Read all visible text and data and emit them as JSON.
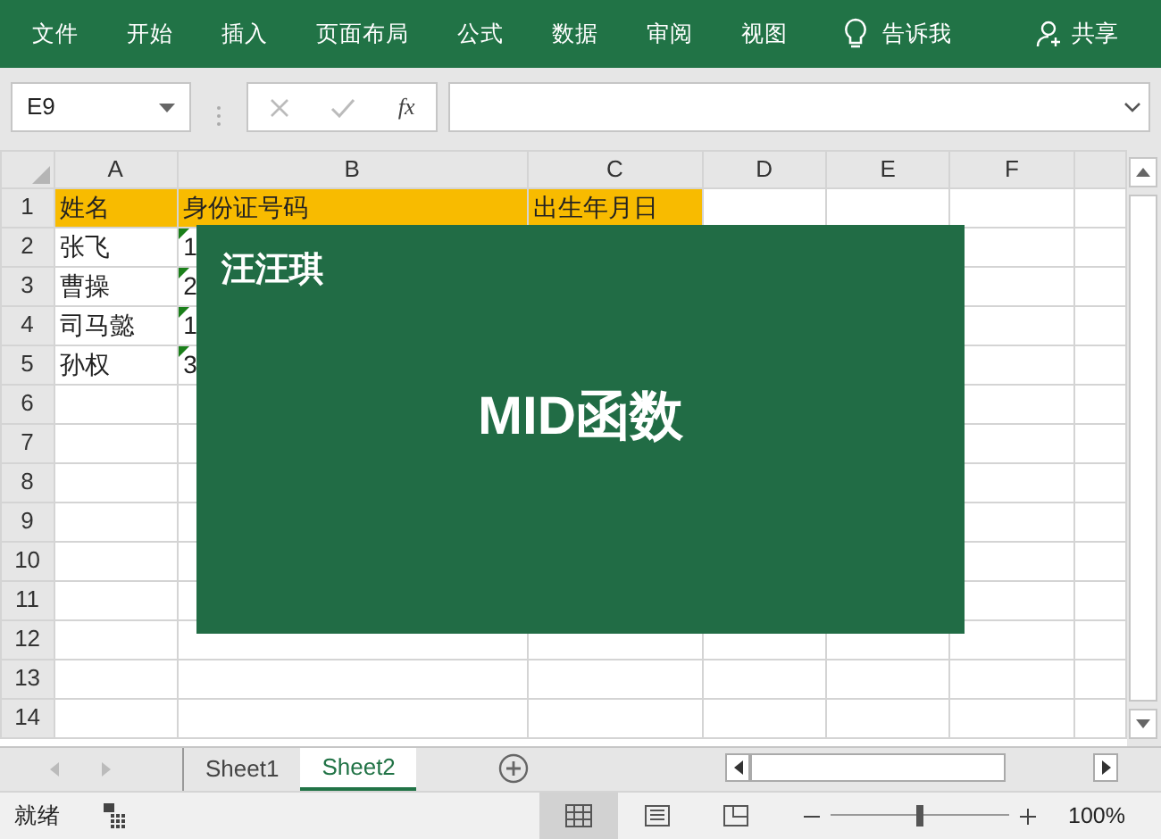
{
  "menu": {
    "tabs": [
      "文件",
      "开始",
      "插入",
      "页面布局",
      "公式",
      "数据",
      "审阅",
      "视图"
    ],
    "tell_me": "告诉我",
    "share": "共享"
  },
  "formula_bar": {
    "name_box": "E9",
    "function_label": "fx"
  },
  "columns": [
    "A",
    "B",
    "C",
    "D",
    "E",
    "F"
  ],
  "rows": [
    {
      "number": "1",
      "highlighted": true,
      "flag": false,
      "cells": [
        "姓名",
        "身份证号码",
        "出生年月日"
      ]
    },
    {
      "number": "2",
      "highlighted": false,
      "flag": true,
      "cells": [
        "张飞",
        "1"
      ]
    },
    {
      "number": "3",
      "highlighted": false,
      "flag": true,
      "cells": [
        "曹操",
        "2"
      ]
    },
    {
      "number": "4",
      "highlighted": false,
      "flag": true,
      "cells": [
        "司马懿",
        "1"
      ]
    },
    {
      "number": "5",
      "highlighted": false,
      "flag": true,
      "cells": [
        "孙权",
        "3"
      ]
    },
    {
      "number": "6",
      "highlighted": false,
      "flag": false,
      "cells": []
    },
    {
      "number": "7",
      "highlighted": false,
      "flag": false,
      "cells": []
    },
    {
      "number": "8",
      "highlighted": false,
      "flag": false,
      "cells": []
    },
    {
      "number": "9",
      "highlighted": false,
      "flag": false,
      "cells": []
    },
    {
      "number": "10",
      "highlighted": false,
      "flag": false,
      "cells": []
    },
    {
      "number": "11",
      "highlighted": false,
      "flag": false,
      "cells": []
    },
    {
      "number": "12",
      "highlighted": false,
      "flag": false,
      "cells": []
    },
    {
      "number": "13",
      "highlighted": false,
      "flag": false,
      "cells": []
    },
    {
      "number": "14",
      "highlighted": false,
      "flag": false,
      "cells": []
    }
  ],
  "overlay": {
    "author": "汪汪琪",
    "title": "MID函数"
  },
  "sheets": [
    {
      "label": "Sheet1",
      "selected": false
    },
    {
      "label": "Sheet2",
      "selected": true
    }
  ],
  "status_bar": {
    "status": "就绪",
    "views": [
      {
        "kind": "normal",
        "selected": true
      },
      {
        "kind": "page-layout",
        "selected": false
      },
      {
        "kind": "page-break",
        "selected": false
      }
    ],
    "zoom": {
      "level": 0.5
    },
    "zoom_text": "100%"
  }
}
